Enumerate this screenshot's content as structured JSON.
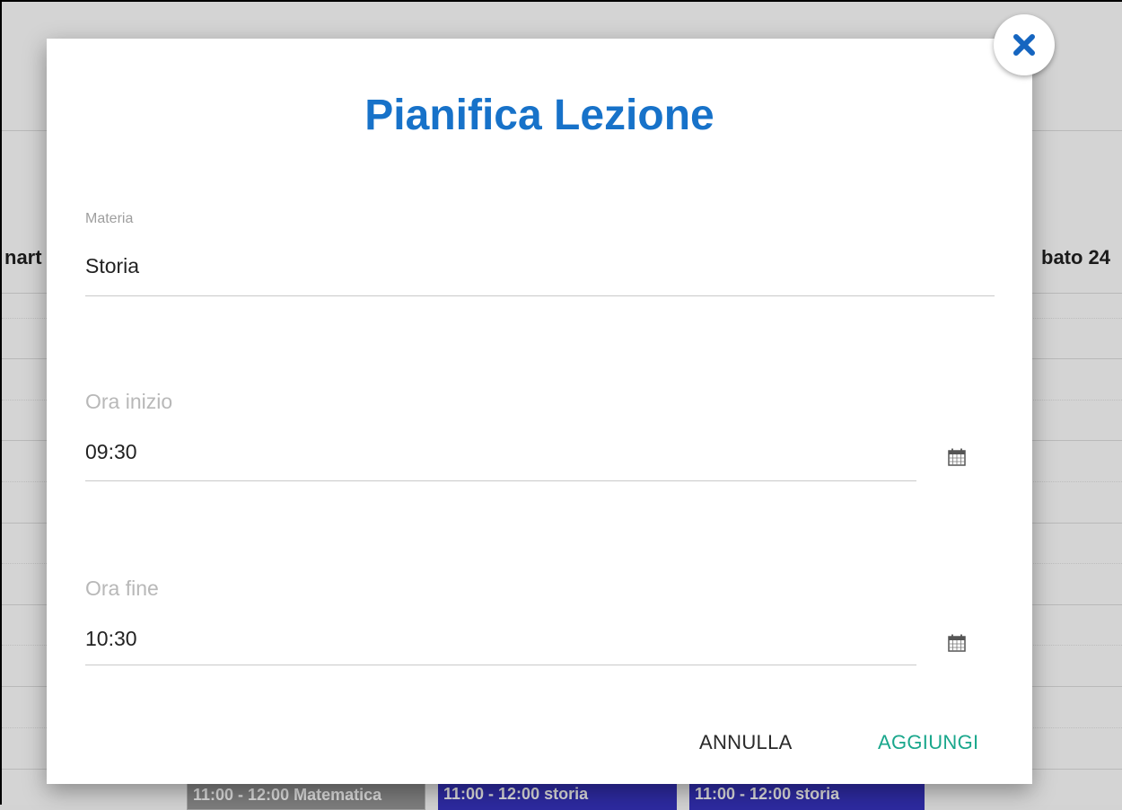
{
  "background": {
    "day_left_label": "nart",
    "day_right_label": "bato 24",
    "events": [
      {
        "text": "11:00 - 12:00 Matematica"
      },
      {
        "text": "11:00 - 12:00 storia"
      },
      {
        "text": "11:00 - 12:00 storia"
      }
    ]
  },
  "dialog": {
    "title": "Pianifica Lezione",
    "close_icon": "close-x-icon",
    "fields": {
      "materia": {
        "label": "Materia",
        "value": "Storia"
      },
      "ora_inizio": {
        "label": "Ora inizio",
        "value": "09:30",
        "icon": "calendar-icon"
      },
      "ora_fine": {
        "label": "Ora fine",
        "value": "10:30",
        "icon": "calendar-icon"
      }
    },
    "actions": {
      "cancel_label": "ANNULLA",
      "add_label": "AGGIUNGI"
    }
  },
  "colors": {
    "title": "#1772c9",
    "close_icon": "#1565c0",
    "add_button": "#1aa78c",
    "event_blue": "#2d2aa0",
    "event_gray": "#7d7d7d"
  }
}
